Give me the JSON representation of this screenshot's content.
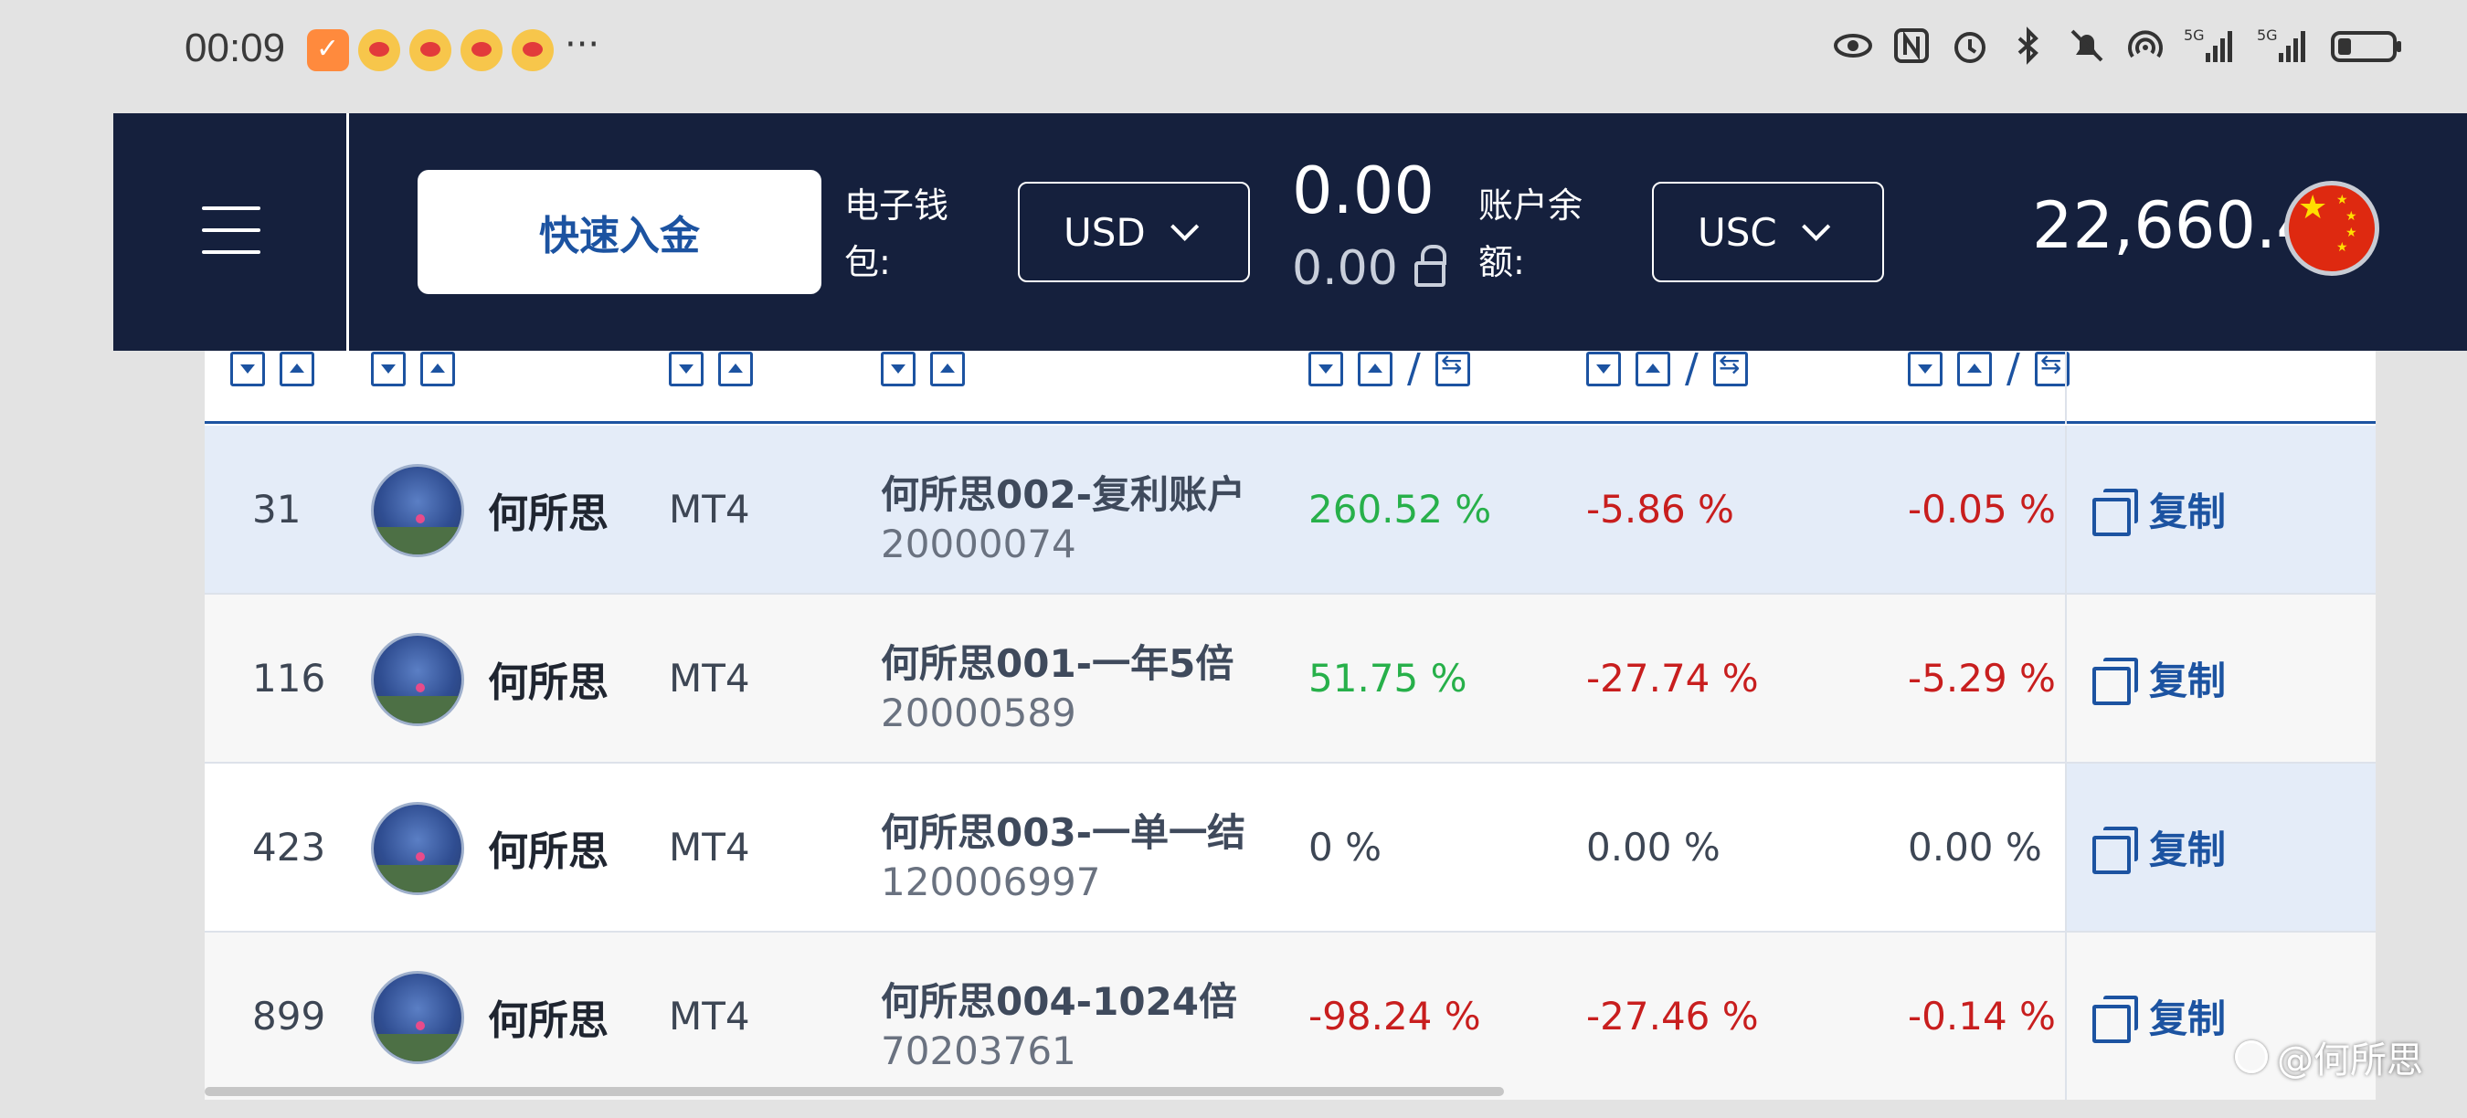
{
  "status_bar": {
    "time": "00:09",
    "more": "···",
    "icons": [
      "eye-icon",
      "nfc-icon",
      "alarm-icon",
      "bluetooth-icon",
      "mute-icon",
      "hotspot-icon",
      "signal-5g-icon",
      "signal-5g-icon",
      "battery-icon"
    ]
  },
  "header": {
    "deposit_button": "快速入金",
    "wallet_label": "电子钱包:",
    "wallet_currency": "USD",
    "wallet_amount": "0.00",
    "wallet_locked": "0.00",
    "balance_label": "账户余额:",
    "balance_currency": "USC",
    "balance_amount": "22,660.46",
    "flag": "cn-flag-icon"
  },
  "table": {
    "rows": [
      {
        "rank": "31",
        "name": "何所思",
        "platform": "MT4",
        "account_name": "何所思002-复利账户",
        "account_id": "20000074",
        "pct1": "260.52 %",
        "pct2": "-5.86 %",
        "pct3": "-0.05 %",
        "copy": "复制"
      },
      {
        "rank": "116",
        "name": "何所思",
        "platform": "MT4",
        "account_name": "何所思001-一年5倍",
        "account_id": "20000589",
        "pct1": "51.75 %",
        "pct2": "-27.74 %",
        "pct3": "-5.29 %",
        "copy": "复制"
      },
      {
        "rank": "423",
        "name": "何所思",
        "platform": "MT4",
        "account_name": "何所思003-一单一结",
        "account_id": "120006997",
        "pct1": "0 %",
        "pct2": "0.00 %",
        "pct3": "0.00 %",
        "copy": "复制"
      },
      {
        "rank": "899",
        "name": "何所思",
        "platform": "MT4",
        "account_name": "何所思004-1024倍",
        "account_id": "70203761",
        "pct1": "-98.24 %",
        "pct2": "-27.46 %",
        "pct3": "-0.14 %",
        "copy": "复制"
      }
    ]
  },
  "sort_slash": "/",
  "watermark": "@何所思",
  "colors": {
    "header_bg": "#15203d",
    "accent": "#1c53a1",
    "positive": "#27b04a",
    "negative": "#c81e1e",
    "highlight_row": "#e4ecf8"
  }
}
